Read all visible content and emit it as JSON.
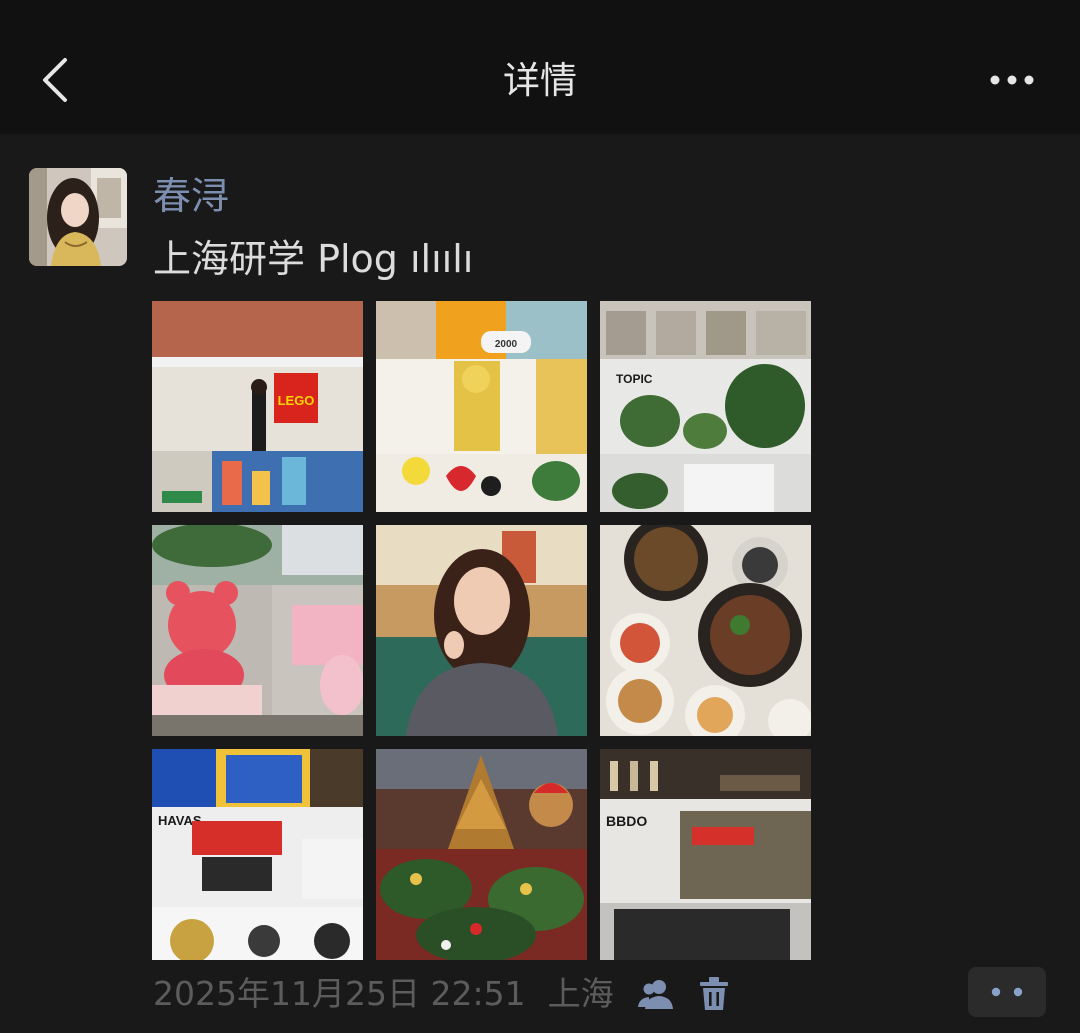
{
  "nav": {
    "title": "详情",
    "back_icon": "chevron-left-icon",
    "more_icon": "more-dots-icon"
  },
  "post": {
    "username": "春浔",
    "text": "上海研学 Plog ılıılı",
    "photos": [
      {
        "label": "LEGO",
        "icon": "photo-lego-office"
      },
      {
        "label": "2000",
        "icon": "photo-lego-figure"
      },
      {
        "label": "TOPIC",
        "icon": "photo-office-plants"
      },
      {
        "label": "",
        "icon": "photo-pink-bear"
      },
      {
        "label": "",
        "icon": "photo-portrait"
      },
      {
        "label": "",
        "icon": "photo-food"
      },
      {
        "label": "HAVAS",
        "icon": "photo-havas-office"
      },
      {
        "label": "",
        "icon": "photo-christmas-tree"
      },
      {
        "label": "BBDO",
        "icon": "photo-bbdo-office"
      }
    ],
    "timestamp": "2025年11月25日 22:51",
    "location": "上海",
    "visibility_icon": "friends-icon",
    "delete_icon": "trash-icon",
    "action_icon": "more-dots-icon"
  },
  "colors": {
    "nav_bg": "#111111",
    "page_bg": "#191919",
    "username": "#7d8fb0",
    "post_text": "#dcdcdc",
    "meta_text": "#5c5c5c",
    "icon_link": "#7d8fb0"
  }
}
